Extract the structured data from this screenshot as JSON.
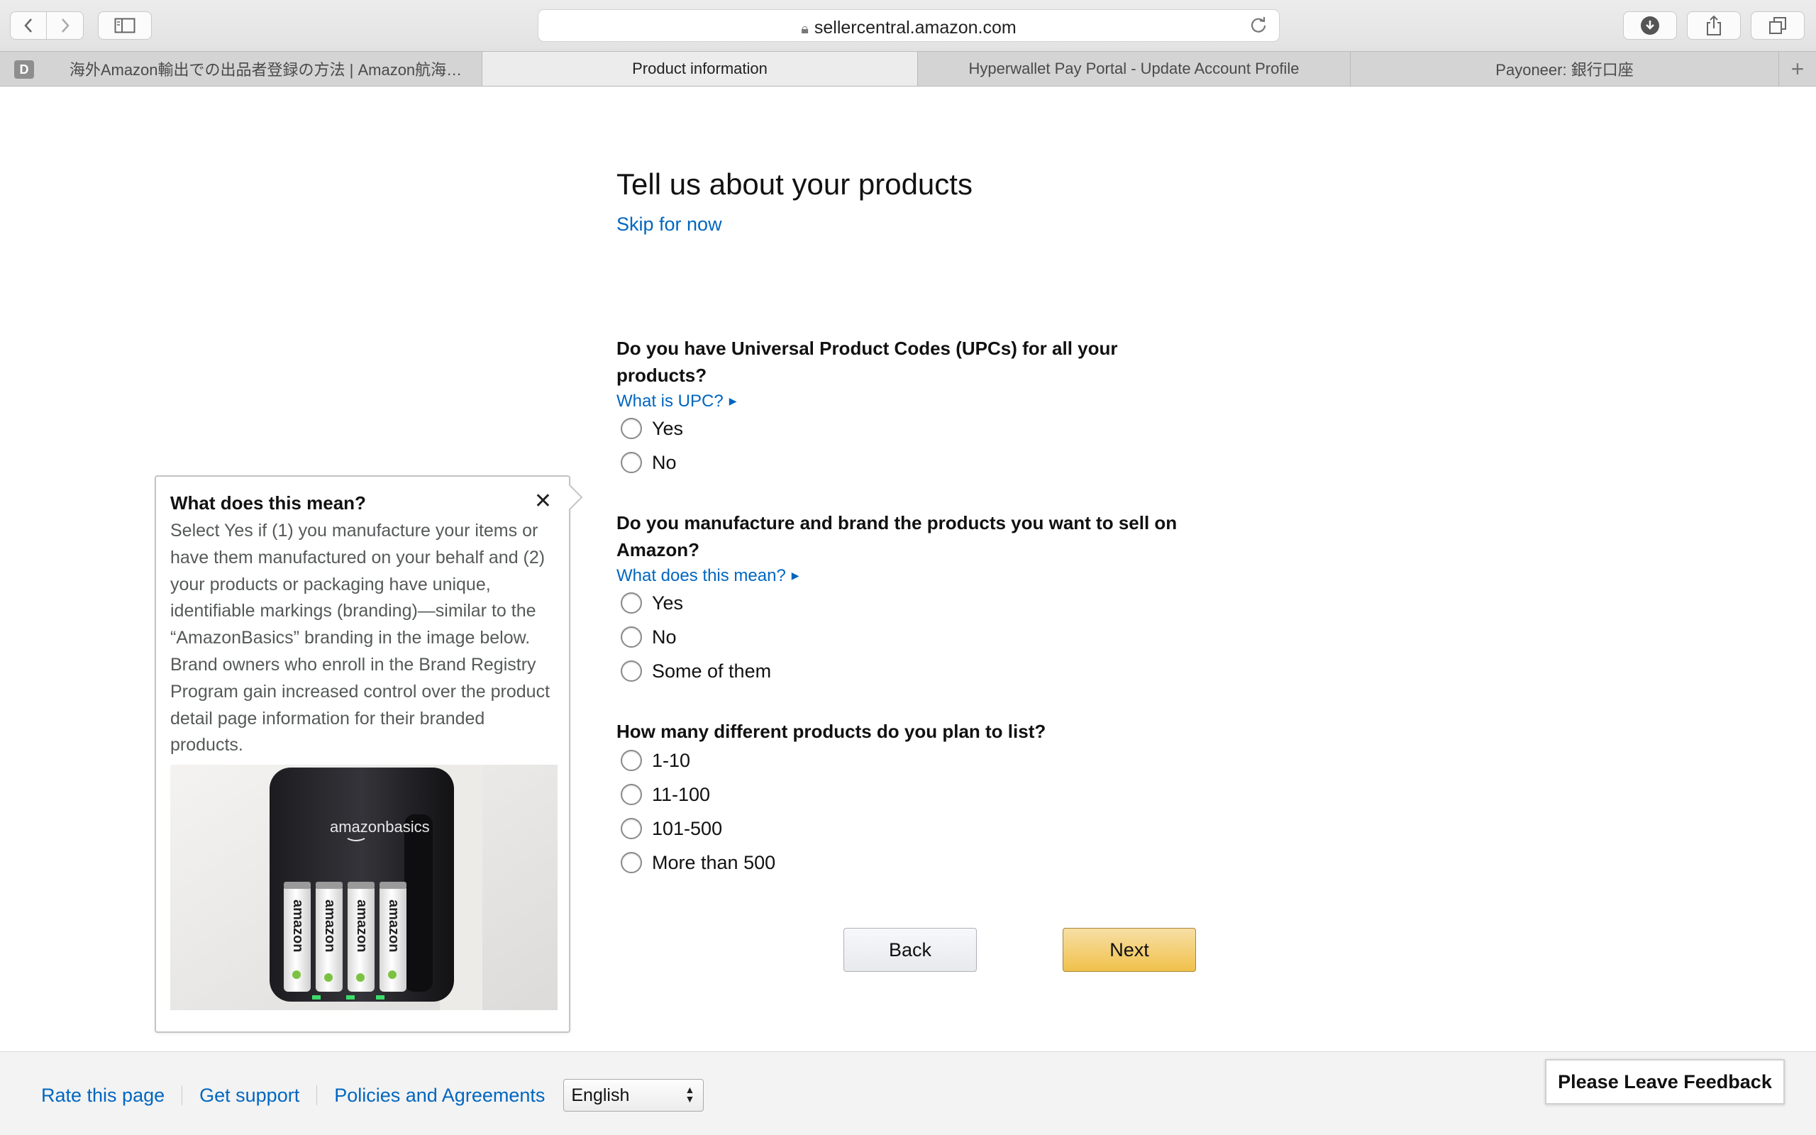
{
  "browser": {
    "url": "sellercentral.amazon.com",
    "tab_badge": "D",
    "tabs": [
      {
        "label": "海外Amazon輸出での出品者登録の方法 | Amazon航海…"
      },
      {
        "label": "Product information"
      },
      {
        "label": "Hyperwallet Pay Portal - Update Account Profile"
      },
      {
        "label": "Payoneer: 銀行口座"
      }
    ]
  },
  "page": {
    "title": "Tell us about your products",
    "skip_label": "Skip for now",
    "questions": [
      {
        "text": "Do you have Universal Product Codes (UPCs) for all your products?",
        "help_label": "What is UPC?",
        "options": [
          "Yes",
          "No"
        ]
      },
      {
        "text": "Do you manufacture and brand the products you want to sell on Amazon?",
        "help_label": "What does this mean?",
        "options": [
          "Yes",
          "No",
          "Some of them"
        ]
      },
      {
        "text": "How many different products do you plan to list?",
        "options": [
          "1-10",
          "11-100",
          "101-500",
          "More than 500"
        ]
      }
    ],
    "back_label": "Back",
    "next_label": "Next"
  },
  "popover": {
    "title": "What does this mean?",
    "close_glyph": "✕",
    "body": "Select Yes if (1) you manufacture your items or have them manufactured on your behalf and (2) your products or packaging have unique, identifiable markings (branding)—similar to the “AmazonBasics” branding in the image below. Brand owners who enroll in the Brand Registry Program gain increased control over the product detail page information for their branded products.",
    "image_logo": "amazonbasics",
    "battery_label": "amazon"
  },
  "footer": {
    "links": [
      "Rate this page",
      "Get support",
      "Policies and Agreements"
    ],
    "language": "English",
    "feedback_label": "Please Leave Feedback"
  },
  "colors": {
    "link": "#0066c0",
    "next_button": "#f0c14b",
    "footer_bg": "#f3f3f3"
  }
}
